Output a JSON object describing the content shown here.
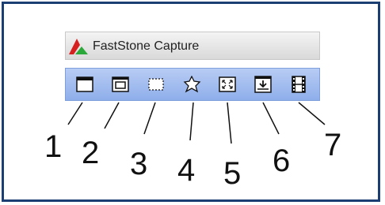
{
  "window": {
    "title": "FastStone Capture",
    "logo_icon": "faststone-logo-icon"
  },
  "toolbar": {
    "tools": [
      {
        "icon": "capture-active-window-icon",
        "number": "1"
      },
      {
        "icon": "capture-window-object-icon",
        "number": "2"
      },
      {
        "icon": "capture-rectangular-region-icon",
        "number": "3"
      },
      {
        "icon": "capture-freehand-region-icon",
        "number": "4"
      },
      {
        "icon": "capture-full-screen-icon",
        "number": "5"
      },
      {
        "icon": "capture-scrolling-window-icon",
        "number": "6"
      },
      {
        "icon": "screen-recorder-icon",
        "number": "7"
      }
    ]
  },
  "colors": {
    "frame": "#1c3f73",
    "toolbar": "#a3bdf0",
    "logo_red": "#d62020",
    "logo_green": "#2aa83a"
  }
}
